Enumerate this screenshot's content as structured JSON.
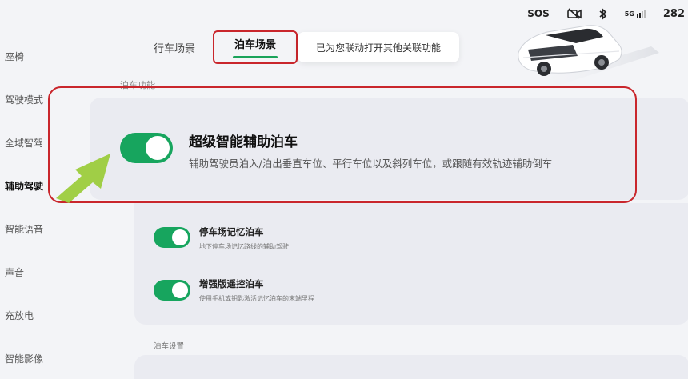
{
  "status_bar": {
    "sos": "SOS",
    "signal": "5G",
    "number": "282"
  },
  "sidebar": {
    "items": [
      {
        "label": "座椅"
      },
      {
        "label": "驾驶模式"
      },
      {
        "label": "全域智驾"
      },
      {
        "label": "辅助驾驶",
        "active": true
      },
      {
        "label": "智能语音"
      },
      {
        "label": "声音"
      },
      {
        "label": "充放电"
      },
      {
        "label": "智能影像"
      }
    ]
  },
  "tabs": {
    "driving": "行车场景",
    "parking": "泊车场景",
    "linked_notice": "已为您联动打开其他关联功能"
  },
  "section_label": "泊车功能",
  "main_feature": {
    "title": "超级智能辅助泊车",
    "description": "辅助驾驶员泊入/泊出垂直车位、平行车位以及斜列车位，或跟随有效轨迹辅助倒车",
    "enabled": true
  },
  "sub_features": [
    {
      "title": "停车场记忆泊车",
      "description": "地下停车场记忆路线的辅助驾驶",
      "enabled": true
    },
    {
      "title": "增强版遥控泊车",
      "description": "使用手机或钥匙激活记忆泊车的末端里程",
      "enabled": true
    }
  ],
  "settings_label": "泊车设置",
  "colors": {
    "accent_green": "#17a55e",
    "highlight_red": "#c9262c",
    "arrow_green": "#9ccc3c"
  }
}
